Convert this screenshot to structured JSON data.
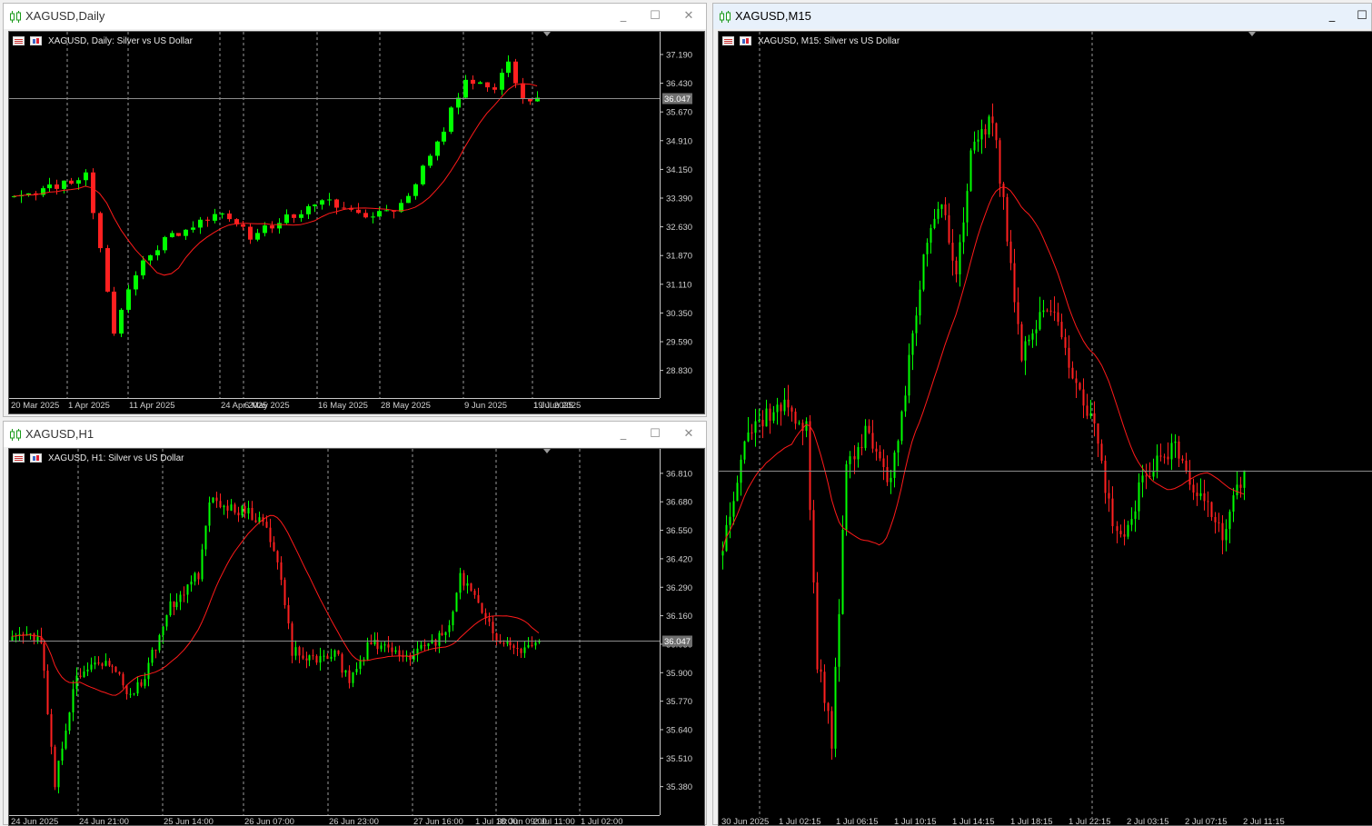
{
  "colors": {
    "bull": "#00ff00",
    "bear": "#ff2020",
    "ma": "#ff1a1a",
    "grid": "#9a9a9a",
    "axis": "#d0d0d0",
    "tag_bg": "#6f6f6f"
  },
  "windows": [
    {
      "title": "XAGUSD,Daily",
      "subtitle": "XAGUSD, Daily:  Silver vs US Dollar",
      "icon": "candlestick-icon",
      "active": false,
      "buttons": {
        "minimize": "_",
        "maximize": "☐",
        "close": "✕"
      },
      "price_tag": "36.047",
      "chart_data": {
        "type": "candlestick",
        "title": "XAGUSD, Daily:  Silver vs US Dollar",
        "ylim": [
          28.1,
          37.55
        ],
        "yticks": [
          "37.190",
          "36.430",
          "35.670",
          "34.910",
          "34.150",
          "33.390",
          "32.630",
          "31.870",
          "31.110",
          "30.350",
          "29.590",
          "28.830"
        ],
        "xticks": [
          "20 Mar 2025",
          "1 Apr 2025",
          "11 Apr 2025",
          "24 Apr 2025",
          "6 May 2025",
          "16 May 2025",
          "28 May 2025",
          "9 Jun 2025",
          "19 Jun 2025",
          "1 Jul 2025"
        ],
        "grid_x_dashed": true,
        "current_price": 36.047,
        "gen": {
          "n": 74,
          "seed": 11,
          "vol": 0.2,
          "anchors": [
            [
              0,
              33.5
            ],
            [
              4,
              33.6
            ],
            [
              10,
              34.0
            ],
            [
              12,
              32.1
            ],
            [
              14,
              29.8
            ],
            [
              16,
              31.0
            ],
            [
              18,
              31.7
            ],
            [
              21,
              32.3
            ],
            [
              28,
              33.0
            ],
            [
              33,
              32.4
            ],
            [
              37,
              32.8
            ],
            [
              44,
              33.3
            ],
            [
              49,
              32.9
            ],
            [
              54,
              33.2
            ],
            [
              60,
              35.2
            ],
            [
              63,
              36.6
            ],
            [
              67,
              36.3
            ],
            [
              69,
              37.0
            ],
            [
              71,
              36.0
            ],
            [
              73,
              36.047
            ]
          ],
          "maPeriod": 10
        }
      }
    },
    {
      "title": "XAGUSD,H1",
      "subtitle": "XAGUSD, H1:  Silver vs US Dollar",
      "icon": "candlestick-icon",
      "active": false,
      "buttons": {
        "minimize": "_",
        "maximize": "☐",
        "close": "✕"
      },
      "price_tag": "36.047",
      "chart_data": {
        "type": "candlestick",
        "title": "XAGUSD, H1:  Silver vs US Dollar",
        "ylim": [
          35.25,
          36.88
        ],
        "yticks": [
          "36.810",
          "36.680",
          "36.550",
          "36.420",
          "36.290",
          "36.160",
          "36.030",
          "35.900",
          "35.770",
          "35.640",
          "35.510",
          "35.380"
        ],
        "xticks": [
          "24 Jun 2025",
          "24 Jun 21:00",
          "25 Jun 14:00",
          "26 Jun 07:00",
          "26 Jun 23:00",
          "27 Jun 16:00",
          "30 Jun 09:00",
          "1 Jul 02:00",
          "1 Jul 18:00",
          "2 Jul 11:00"
        ],
        "grid_x_dashed": true,
        "current_price": 36.047,
        "gen": {
          "n": 148,
          "seed": 23,
          "vol": 0.045,
          "anchors": [
            [
              0,
              36.08
            ],
            [
              8,
              36.05
            ],
            [
              12,
              35.4
            ],
            [
              18,
              35.9
            ],
            [
              28,
              35.95
            ],
            [
              32,
              35.8
            ],
            [
              36,
              35.85
            ],
            [
              44,
              36.2
            ],
            [
              52,
              36.35
            ],
            [
              55,
              36.7
            ],
            [
              62,
              36.65
            ],
            [
              70,
              36.6
            ],
            [
              74,
              36.4
            ],
            [
              78,
              36.0
            ],
            [
              84,
              35.95
            ],
            [
              90,
              36.0
            ],
            [
              94,
              35.85
            ],
            [
              100,
              36.05
            ],
            [
              106,
              36.0
            ],
            [
              112,
              35.98
            ],
            [
              118,
              36.05
            ],
            [
              122,
              36.1
            ],
            [
              125,
              36.35
            ],
            [
              130,
              36.2
            ],
            [
              135,
              36.05
            ],
            [
              140,
              36.0
            ],
            [
              147,
              36.047
            ]
          ],
          "maPeriod": 20
        }
      }
    },
    {
      "title": "XAGUSD,M15",
      "subtitle": "XAGUSD, M15:  Silver vs US Dollar",
      "icon": "candlestick-icon",
      "active": true,
      "buttons": {
        "minimize": "_",
        "maximize": "☐",
        "close": "✕"
      },
      "price_tag": "",
      "chart_data": {
        "type": "candlestick",
        "title": "XAGUSD, M15:  Silver vs US Dollar",
        "ylim": [
          35.6,
          36.6
        ],
        "yticks": [],
        "xticks": [
          "30 Jun 2025",
          "1 Jul 02:15",
          "1 Jul 06:15",
          "1 Jul 10:15",
          "1 Jul 14:15",
          "1 Jul 18:15",
          "1 Jul 22:15",
          "2 Jul 03:15",
          "2 Jul 07:15",
          "2 Jul 11:15"
        ],
        "grid_x_dashed": true,
        "current_price": 36.047,
        "gen": {
          "n": 144,
          "seed": 37,
          "vol": 0.022,
          "anchors": [
            [
              0,
              35.95
            ],
            [
              6,
              36.09
            ],
            [
              12,
              36.12
            ],
            [
              18,
              36.13
            ],
            [
              23,
              36.1
            ],
            [
              26,
              35.8
            ],
            [
              30,
              35.7
            ],
            [
              34,
              36.05
            ],
            [
              40,
              36.1
            ],
            [
              46,
              36.03
            ],
            [
              50,
              36.15
            ],
            [
              56,
              36.35
            ],
            [
              60,
              36.4
            ],
            [
              64,
              36.3
            ],
            [
              68,
              36.45
            ],
            [
              74,
              36.5
            ],
            [
              78,
              36.35
            ],
            [
              82,
              36.2
            ],
            [
              88,
              36.25
            ],
            [
              92,
              36.25
            ],
            [
              97,
              36.15
            ],
            [
              102,
              36.1
            ],
            [
              106,
              36.0
            ],
            [
              110,
              35.95
            ],
            [
              114,
              36.02
            ],
            [
              118,
              36.05
            ],
            [
              124,
              36.08
            ],
            [
              128,
              36.04
            ],
            [
              132,
              36.0
            ],
            [
              137,
              35.97
            ],
            [
              143,
              36.05
            ]
          ],
          "maPeriod": 20
        }
      }
    }
  ]
}
